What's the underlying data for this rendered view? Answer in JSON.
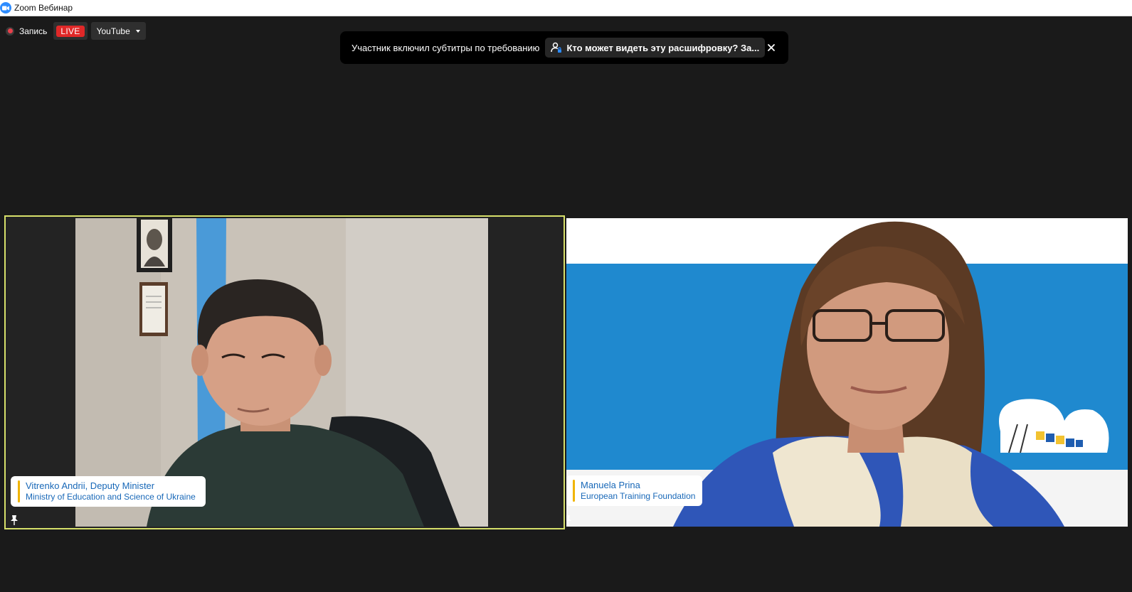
{
  "window": {
    "title": "Zoom Вебинар",
    "icon": "zoom-logo-icon"
  },
  "recording": {
    "label": "Запись",
    "live_badge": "LIVE",
    "stream_target": "YouTube"
  },
  "banner": {
    "message": "Участник включил субтитры по требованию",
    "link_text": "Кто может видеть эту расшифровку? За...",
    "close_icon": "close-icon"
  },
  "participants": [
    {
      "name": "Vitrenko Andrii, Deputy Minister",
      "organization": "Ministry of Education and Science of Ukraine",
      "active_speaker": true
    },
    {
      "name": "Manuela Prina",
      "organization": "European Training Foundation",
      "active_speaker": false
    }
  ],
  "colors": {
    "active_speaker_border": "#d7e06a",
    "live_red": "#e02828",
    "nametag_text": "#1868b8",
    "nametag_accent": "#f0b400",
    "banner_bg": "#000000"
  }
}
